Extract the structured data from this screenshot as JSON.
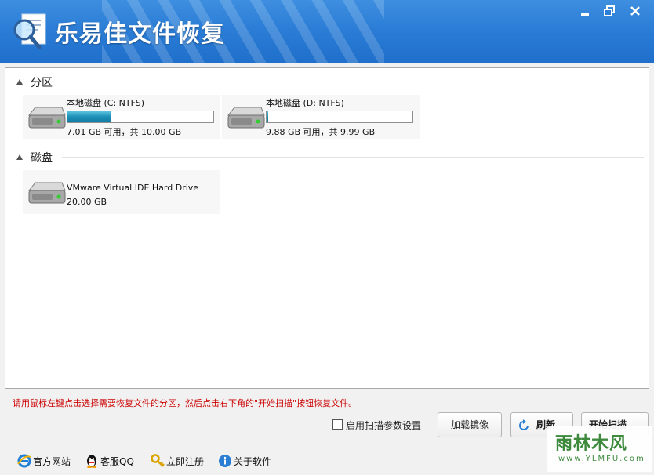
{
  "app": {
    "title": "乐易佳文件恢复"
  },
  "sections": {
    "partitions_label": "分区",
    "disks_label": "磁盘"
  },
  "partitions": [
    {
      "name": "本地磁盘 (C: NTFS)",
      "info": "7.01 GB 可用，共 10.00 GB",
      "used_fraction": 0.3
    },
    {
      "name": "本地磁盘 (D: NTFS)",
      "info": "9.88 GB 可用，共 9.99 GB",
      "used_fraction": 0.01
    }
  ],
  "disks": [
    {
      "name": "VMware Virtual IDE Hard Drive",
      "size": "20.00 GB"
    }
  ],
  "hint": "请用鼠标左键点击选择需要恢复文件的分区，然后点击右下角的\"开始扫描\"按钮恢复文件。",
  "controls": {
    "scan_params_label": "启用扫描参数设置",
    "scan_params_checked": false,
    "mount_image_label": "加载镜像",
    "refresh_label": "刷新",
    "start_scan_label": "开始扫描"
  },
  "footer": {
    "website": "官方网站",
    "support_qq": "客服QQ",
    "register": "立即注册",
    "about": "关于软件"
  },
  "watermark": {
    "main": "雨林木风",
    "sub": "www.YLMFU.com"
  },
  "colors": {
    "titlebar": "#2b7dd6",
    "hint": "#cc0000",
    "progress": "#1d8fb5"
  },
  "icons": {
    "app": "magnifier-document-icon",
    "drive": "hard-drive-icon",
    "refresh": "refresh-icon",
    "website": "ie-icon",
    "qq": "qq-penguin-icon",
    "register": "key-icon",
    "about": "info-icon"
  }
}
